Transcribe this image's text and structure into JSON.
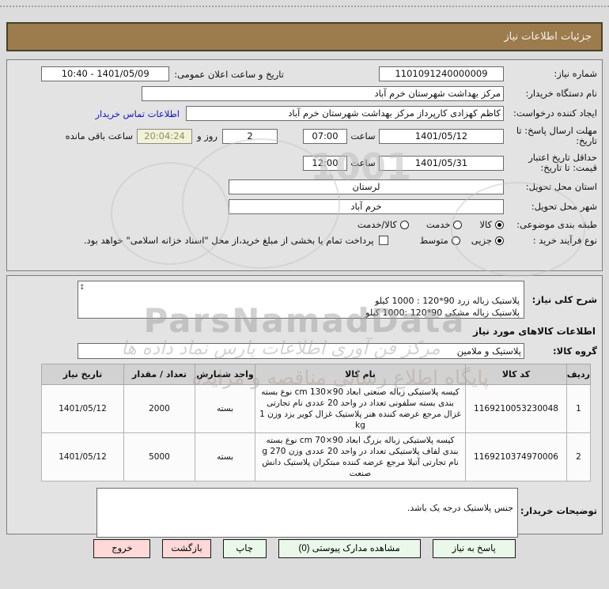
{
  "page": {
    "title_bar": "جزئیات اطلاعات نیاز"
  },
  "info": {
    "need_number": {
      "label": "شماره نیاز:",
      "value": "1101091240000009"
    },
    "announce": {
      "label": "تاریخ و ساعت اعلان عمومی:",
      "value": "1401/05/09 - 10:40"
    },
    "buyer_org": {
      "label": "نام دستگاه خریدار:",
      "value": "مرکز بهداشت شهرستان خرم آباد"
    },
    "creator": {
      "label": "ایجاد کننده درخواست:",
      "value": "کاظم کهزادی کارپرداز مرکز بهداشت شهرستان خرم آباد"
    },
    "buyer_contact_link": "اطلاعات تماس خریدار",
    "reply_deadline": {
      "label": "مهلت ارسال پاسخ: تا تاریخ:",
      "date": "1401/05/12",
      "hour_label": "ساعت",
      "hour": "07:00",
      "days_value": "2",
      "days_label": "روز و",
      "countdown": "20:04:24",
      "countdown_label": "ساعت باقی مانده"
    },
    "price_validity": {
      "label": "حداقل تاریخ اعتبار قیمت: تا تاریخ:",
      "date": "1401/05/31",
      "hour_label": "ساعت",
      "hour": "12:00"
    },
    "province": {
      "label": "استان محل تحویل:",
      "value": "لرستان"
    },
    "city": {
      "label": "شهر محل تحویل:",
      "value": "خرم آباد"
    },
    "classification": {
      "label": "طبقه بندی موضوعی:",
      "options": [
        {
          "label": "کالا",
          "selected": true
        },
        {
          "label": "خدمت",
          "selected": false
        },
        {
          "label": "کالا/خدمت",
          "selected": false
        }
      ]
    },
    "process_type": {
      "label": "نوع فرآیند خرید :",
      "options": [
        {
          "label": "جزیی",
          "selected": true
        },
        {
          "label": "متوسط",
          "selected": false
        }
      ],
      "checkbox_label": "پرداخت تمام یا بخشی از مبلغ خرید،از محل \"اسناد خزانه اسلامی\" خواهد بود.",
      "checkbox_checked": false
    }
  },
  "need_section": {
    "desc_label": "شرح کلی نیاز:",
    "desc_value": "پلاستیک زباله زرد 90*120 : 1000 کیلو\nپلاستیک زباله مشکی 90*120 :1000 کیلو",
    "goods_header": "اطلاعات کالاهای مورد نیاز",
    "group_label": "گروه کالا:",
    "group_value": "پلاستیک و ملامین"
  },
  "table": {
    "headers": [
      "ردیف",
      "کد کالا",
      "نام کالا",
      "واحد شمارش",
      "تعداد / مقدار",
      "تاریخ نیاز"
    ],
    "rows": [
      {
        "row": "1",
        "code": "1169210053230048",
        "name": "کیسه پلاستیکی زباله صنعتی ابعاد 90×130 cm نوع بسته بندی بسته سلفونی تعداد در واحد 20 عددی نام تجارتی غزال مرجع عرضه کننده هنر پلاستیک غزال کویر یزد وزن 1 kg",
        "unit": "بسته",
        "qty": "2000",
        "date": "1401/05/12"
      },
      {
        "row": "2",
        "code": "1169210374970006",
        "name": "کیسه پلاستیکی زباله بزرگ ابعاد 90×70 cm نوع بسته بندی لفاف پلاستیکی تعداد در واحد 20 عددی وزن 270 g نام تجارتی آتیلا مرجع عرضه کننده مبتکران پلاستیک دانش صنعت",
        "unit": "بسته",
        "qty": "5000",
        "date": "1401/05/12"
      }
    ]
  },
  "buyer_notes": {
    "label": "توضیحات خریدار:",
    "value": "جنس پلاستیک درجه یک باشد."
  },
  "buttons": {
    "reply": "پاسخ به نیاز",
    "view_docs": "مشاهده مدارک پیوستی (0)",
    "print": "چاپ",
    "back": "بازگشت",
    "exit": "خروج"
  },
  "watermark": {
    "latin": "ParsNamadData",
    "fa1": "مرکز فن آوری اطلاعات پارس نماد داده ها",
    "fa2": "پایگاه اطلاع رسانی مناقصه و مزایده",
    "digits": "1001"
  },
  "colors": {
    "title_bar_bg": "#9c7b4c",
    "button_green": "#e9f8e9",
    "button_pink": "#ffd8d8",
    "countdown_bg": "#f2f2d8",
    "link_blue": "#1414cc"
  }
}
